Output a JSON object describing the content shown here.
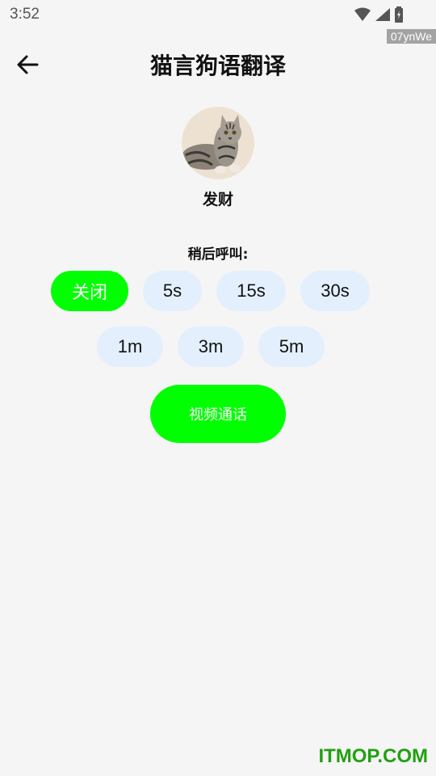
{
  "status_bar": {
    "time": "3:52",
    "badge": "07ynWe"
  },
  "header": {
    "title": "猫言狗语翻译"
  },
  "pet": {
    "name": "发财"
  },
  "call_later": {
    "label": "稍后呼叫:",
    "options": [
      "关闭",
      "5s",
      "15s",
      "30s",
      "1m",
      "3m",
      "5m"
    ],
    "selected": "关闭"
  },
  "actions": {
    "video_call": "视频通话"
  },
  "watermark": "ITMOP.COM",
  "colors": {
    "accent": "#00ff00",
    "chip_bg": "#e3effc",
    "background": "#f5f5f5",
    "watermark": "#22a012"
  }
}
